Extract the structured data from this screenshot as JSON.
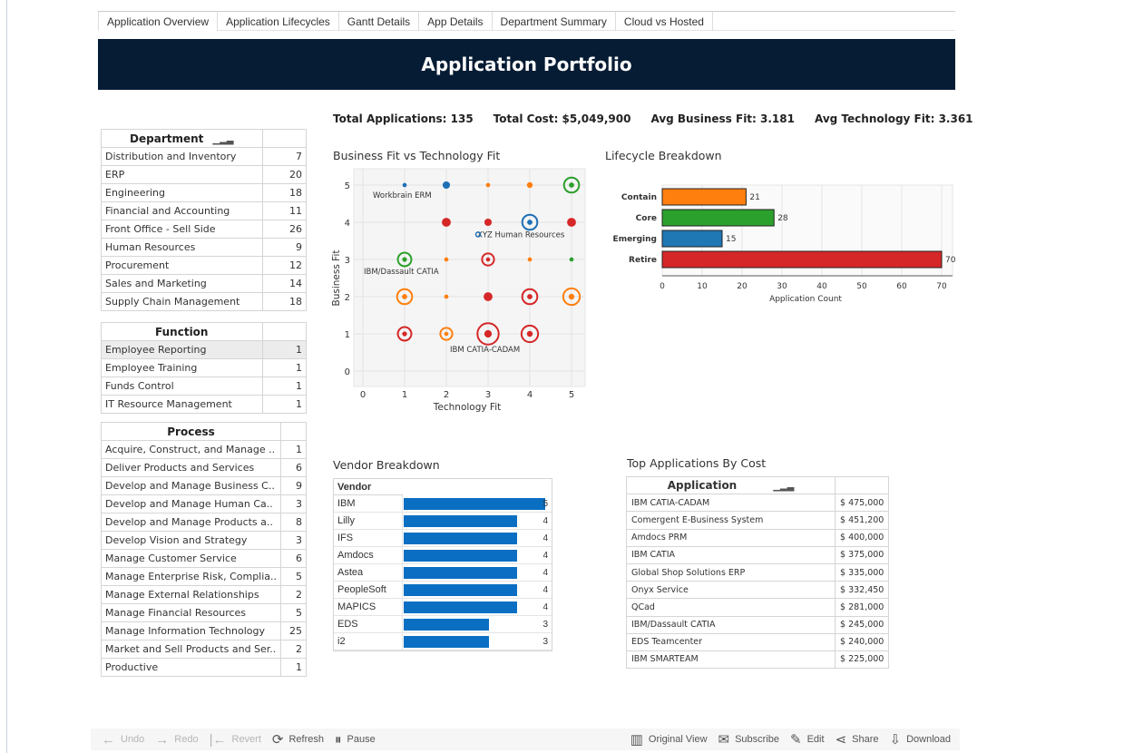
{
  "tabs": [
    "Application Overview",
    "Application Lifecycles",
    "Gantt Details",
    "App Details",
    "Department Summary",
    "Cloud vs Hosted"
  ],
  "banner_title": "Application Portfolio",
  "kpis": {
    "total_apps": "Total Applications: 135",
    "total_cost": "Total Cost: $5,049,900",
    "avg_business": "Avg Business Fit: 3.181",
    "avg_tech": "Avg Technology Fit: 3.361"
  },
  "department": {
    "header": "Department",
    "rows": [
      {
        "name": "Distribution and Inventory",
        "value": "7"
      },
      {
        "name": "ERP",
        "value": "20"
      },
      {
        "name": "Engineering",
        "value": "18"
      },
      {
        "name": "Financial and Accounting",
        "value": "11"
      },
      {
        "name": "Front Office - Sell Side",
        "value": "26"
      },
      {
        "name": "Human Resources",
        "value": "9"
      },
      {
        "name": "Procurement",
        "value": "12"
      },
      {
        "name": "Sales and Marketing",
        "value": "14"
      },
      {
        "name": "Supply Chain Management",
        "value": "18"
      }
    ]
  },
  "function": {
    "header": "Function",
    "rows": [
      {
        "name": "Employee Reporting",
        "value": "1"
      },
      {
        "name": "Employee Training",
        "value": "1"
      },
      {
        "name": "Funds Control",
        "value": "1"
      },
      {
        "name": "IT Resource Management",
        "value": "1"
      }
    ]
  },
  "process": {
    "header": "Process",
    "rows": [
      {
        "name": "Acquire, Construct, and Manage ..",
        "value": "1"
      },
      {
        "name": "Deliver Products and Services",
        "value": "6"
      },
      {
        "name": "Develop and Manage Business C..",
        "value": "9"
      },
      {
        "name": "Develop and Manage Human Ca..",
        "value": "3"
      },
      {
        "name": "Develop and Manage Products a..",
        "value": "8"
      },
      {
        "name": "Develop Vision and Strategy",
        "value": "3"
      },
      {
        "name": "Manage Customer Service",
        "value": "6"
      },
      {
        "name": "Manage Enterprise Risk, Complia..",
        "value": "5"
      },
      {
        "name": "Manage External Relationships",
        "value": "2"
      },
      {
        "name": "Manage Financial Resources",
        "value": "5"
      },
      {
        "name": "Manage Information Technology",
        "value": "25"
      },
      {
        "name": "Market and Sell Products and Ser..",
        "value": "2"
      },
      {
        "name": "Productive",
        "value": "1"
      }
    ]
  },
  "scatter_title": "Business Fit vs Technology Fit",
  "lifecycle_title": "Lifecycle Breakdown",
  "vendor_title": "Vendor Breakdown",
  "topapps_title": "Top Applications By Cost",
  "chart_data": [
    {
      "type": "scatter",
      "title": "Business Fit vs Technology Fit",
      "xlabel": "Technology Fit",
      "ylabel": "Business Fit",
      "xlim": [
        0,
        5
      ],
      "ylim": [
        0,
        5
      ],
      "xticks": [
        "0",
        "1",
        "2",
        "3",
        "4",
        "5"
      ],
      "yticks": [
        "0",
        "1",
        "2",
        "3",
        "4",
        "5"
      ],
      "points": [
        {
          "x": 1,
          "y": 5,
          "size": 1,
          "color": "#1f6fb4"
        },
        {
          "x": 2,
          "y": 5,
          "size": 3,
          "color": "#1f6fb4"
        },
        {
          "x": 3,
          "y": 5,
          "size": 1,
          "color": "#ff7f0e"
        },
        {
          "x": 4,
          "y": 5,
          "size": 2,
          "color": "#ff7f0e"
        },
        {
          "x": 5,
          "y": 5,
          "size": 8,
          "color": "#2ca02c",
          "ring": true
        },
        {
          "x": 2,
          "y": 4,
          "size": 4,
          "color": "#d62728"
        },
        {
          "x": 3,
          "y": 4,
          "size": 3,
          "color": "#d62728"
        },
        {
          "x": 4,
          "y": 4,
          "size": 8,
          "color": "#1f6fb4",
          "ring": true
        },
        {
          "x": 5,
          "y": 4,
          "size": 4,
          "color": "#d62728"
        },
        {
          "x": 1,
          "y": 3,
          "size": 7,
          "color": "#2ca02c",
          "ring": true
        },
        {
          "x": 2,
          "y": 3,
          "size": 1,
          "color": "#ff7f0e"
        },
        {
          "x": 3,
          "y": 3,
          "size": 6,
          "color": "#d62728",
          "ring": true
        },
        {
          "x": 4,
          "y": 3,
          "size": 1,
          "color": "#ff7f0e"
        },
        {
          "x": 5,
          "y": 3,
          "size": 1,
          "color": "#2ca02c"
        },
        {
          "x": 1,
          "y": 2,
          "size": 8,
          "color": "#ff7f0e",
          "ring": true
        },
        {
          "x": 2,
          "y": 2,
          "size": 1,
          "color": "#ff7f0e"
        },
        {
          "x": 3,
          "y": 2,
          "size": 4,
          "color": "#d62728"
        },
        {
          "x": 4,
          "y": 2,
          "size": 8,
          "color": "#d62728",
          "ring": true
        },
        {
          "x": 5,
          "y": 2,
          "size": 9,
          "color": "#ff7f0e",
          "ring": true
        },
        {
          "x": 1,
          "y": 1,
          "size": 7,
          "color": "#d62728",
          "ring": true
        },
        {
          "x": 2,
          "y": 1,
          "size": 6,
          "color": "#ff7f0e",
          "ring": true
        },
        {
          "x": 3,
          "y": 1,
          "size": 12,
          "color": "#d62728",
          "ring": true
        },
        {
          "x": 4,
          "y": 1,
          "size": 9,
          "color": "#d62728",
          "ring": true
        }
      ],
      "annotations": [
        {
          "x": 1,
          "y": 5,
          "text": "Workbrain ERM"
        },
        {
          "x": 3,
          "y": 3.6,
          "text": "XYZ Human Resources"
        },
        {
          "x": 1,
          "y": 3,
          "text": "IBM/Dassault CATIA"
        },
        {
          "x": 3,
          "y": 1,
          "text": "IBM CATIA-CADAM"
        }
      ]
    },
    {
      "type": "bar",
      "title": "Lifecycle Breakdown",
      "xlabel": "Application Count",
      "categories": [
        "Contain",
        "Core",
        "Emerging",
        "Retire"
      ],
      "values": [
        21,
        28,
        15,
        70
      ],
      "colors": [
        "#ff7f0e",
        "#2ca02c",
        "#1f77b4",
        "#d62728"
      ],
      "xlim": [
        0,
        75
      ],
      "xticks": [
        "0",
        "10",
        "20",
        "30",
        "40",
        "50",
        "60",
        "70"
      ]
    },
    {
      "type": "bar",
      "title": "Vendor Breakdown",
      "header": "Vendor",
      "categories": [
        "IBM",
        "Lilly",
        "IFS",
        "Amdocs",
        "Astea",
        "PeopleSoft",
        "MAPICS",
        "EDS",
        "i2"
      ],
      "values": [
        5,
        4,
        4,
        4,
        4,
        4,
        4,
        3,
        3
      ],
      "color": "#0a6fc2"
    },
    {
      "type": "table",
      "title": "Top Applications By Cost",
      "header": "Application",
      "rows": [
        {
          "name": "IBM CATIA-CADAM",
          "cost": "$ 475,000"
        },
        {
          "name": "Comergent E-Business System",
          "cost": "$ 451,200"
        },
        {
          "name": "Amdocs PRM",
          "cost": "$ 400,000"
        },
        {
          "name": "IBM CATIA",
          "cost": "$ 375,000"
        },
        {
          "name": "Global Shop Solutions ERP",
          "cost": "$ 335,000"
        },
        {
          "name": "Onyx Service",
          "cost": "$ 332,450"
        },
        {
          "name": "QCad",
          "cost": "$ 281,000"
        },
        {
          "name": "IBM/Dassault CATIA",
          "cost": "$ 245,000"
        },
        {
          "name": "EDS Teamcenter",
          "cost": "$ 240,000"
        },
        {
          "name": "IBM SMARTEAM",
          "cost": "$ 225,000"
        }
      ]
    }
  ],
  "toolbar": {
    "undo": "Undo",
    "redo": "Redo",
    "revert": "Revert",
    "refresh": "Refresh",
    "pause": "Pause",
    "original_view": "Original View",
    "subscribe": "Subscribe",
    "edit": "Edit",
    "share": "Share",
    "download": "Download"
  }
}
